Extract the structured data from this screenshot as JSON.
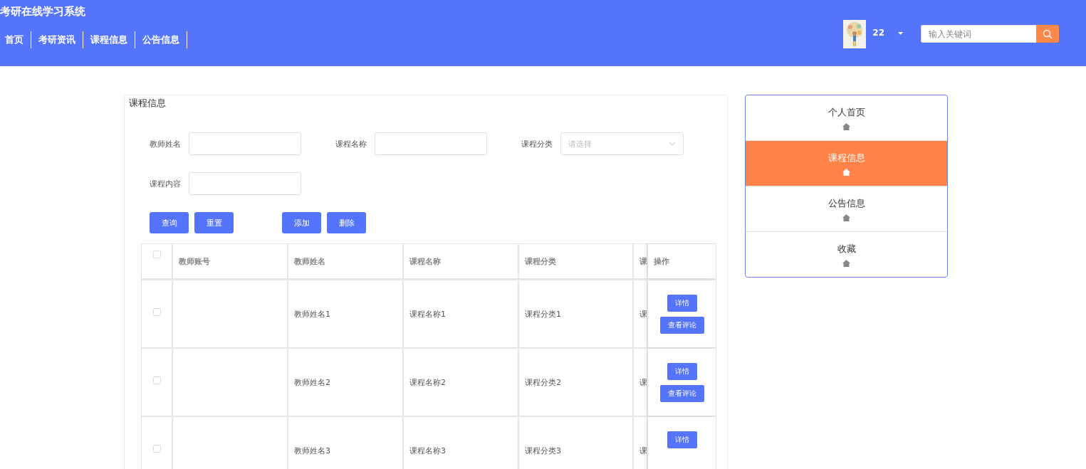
{
  "site_title": "考研在线学习系统",
  "nav": [
    {
      "label": "首页"
    },
    {
      "label": "考研资讯"
    },
    {
      "label": "课程信息"
    },
    {
      "label": "公告信息"
    }
  ],
  "user": {
    "name": "22"
  },
  "search": {
    "placeholder": "输入关键词"
  },
  "panel": {
    "title": "课程信息",
    "filters": [
      {
        "label": "教师姓名",
        "kind": "text"
      },
      {
        "label": "课程名称",
        "kind": "text"
      },
      {
        "label": "课程分类",
        "kind": "select",
        "placeholder": "请选择"
      },
      {
        "label": "课程内容",
        "kind": "text"
      }
    ],
    "buttons": [
      "查询",
      "重置",
      "添加",
      "删除"
    ],
    "table": {
      "all_checked": false,
      "columns": [
        "教师账号",
        "教师姓名",
        "课程名称",
        "课程分类",
        "课",
        "操作"
      ],
      "rows": [
        {
          "checked": false,
          "cells": [
            "",
            "教师姓名1",
            "课程名称1",
            "课程分类1",
            "课"
          ],
          "actions": [
            "详情",
            "查看评论"
          ]
        },
        {
          "checked": false,
          "cells": [
            "",
            "教师姓名2",
            "课程名称2",
            "课程分类2",
            "课"
          ],
          "actions": [
            "详情",
            "查看评论"
          ]
        },
        {
          "checked": false,
          "cells": [
            "",
            "教师姓名3",
            "课程名称3",
            "课程分类3",
            "课"
          ],
          "actions": [
            "详情"
          ]
        }
      ]
    }
  },
  "sidebar": {
    "items": [
      {
        "label": "个人首页",
        "selected": false
      },
      {
        "label": "课程信息",
        "selected": true
      },
      {
        "label": "公告信息",
        "selected": false
      },
      {
        "label": "收藏",
        "selected": false
      }
    ]
  }
}
